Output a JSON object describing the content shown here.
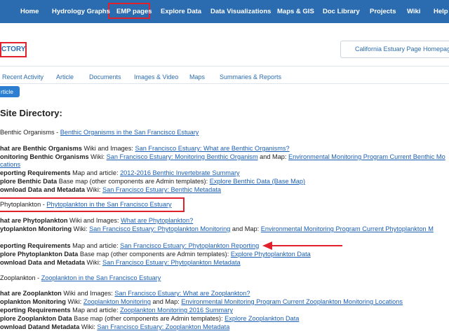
{
  "nav": {
    "items": [
      "Home",
      "Hydrology Graphs",
      "EMP pages",
      "Explore Data",
      "Data Visualizations",
      "Maps & GIS",
      "Doc Library",
      "Projects",
      "Wiki",
      "Help"
    ]
  },
  "header": {
    "title": "CTORY",
    "home_button": "California Estuary Page Homepage"
  },
  "tabs": [
    "Recent Activity",
    "Article",
    "Documents",
    "Images & Video",
    "Maps",
    "Summaries & Reports"
  ],
  "active_button": "rticle",
  "page_heading": "Site Directory:",
  "sections": {
    "benthic": {
      "title_prefix": "Benthic Organisms - ",
      "title_link": "Benthic Organisms in the San Francisco Estuary",
      "rows": [
        {
          "b": "hat are Benthic Organisms",
          "t1": " Wiki and Images: ",
          "l1": "San Francisco Estuary: What are Benthic Organisms?"
        },
        {
          "b": "onitoring Benthic Organisms",
          "t1": " Wiki: ",
          "l1": "San Francisco Estuary: Monitoring Benthic Organism",
          "t2": " and Map: ",
          "l2": "Environmental Monitoring Program Current Benthic Mo"
        },
        {
          "b": "",
          "t1": "",
          "l1": "cations"
        },
        {
          "b": "eporting Requirements",
          "t1": " Map and article: ",
          "l1": "2012-2016 Benthic Invertebrate Summary"
        },
        {
          "b": "plore Benthic Data",
          "t1": " Base map (other components are Admin templates): ",
          "l1": "Explore Benthic Data (Base Map)"
        },
        {
          "b": "ownload Data and Metadata",
          "t1": " Wiki: ",
          "l1": "San Francisco Estuary: Benthic Metadata"
        }
      ]
    },
    "phyto": {
      "title_prefix": "Phytoplankton - ",
      "title_link": "Phytoplankton in the San Francisco Estuary",
      "rows": [
        {
          "b": "hat are Phytoplankton",
          "t1": " Wiki and Images: ",
          "l1": "What are Phytoplankton?"
        },
        {
          "b": "ytoplankton Monitoring",
          "t1": " Wiki: ",
          "l1": "San Francisco Estuary: Phytoplankton Monitoring",
          "t2": " and Map: ",
          "l2": "Environmental Monitoring Program Current Phytoplankton M"
        },
        {
          "b": "eporting Requirements",
          "t1": " Map and article: ",
          "l1": "San Francisco Estuary: Phytoplankton Reporting"
        },
        {
          "b": "plore Phytoplankton Data",
          "t1": " Base map (other components are Admin templates): ",
          "l1": "Explore Phytoplankton Data"
        },
        {
          "b": "ownload Data and Metadata",
          "t1": " Wiki: ",
          "l1": "San Francisco Estuary: Phytoplankton Metadata"
        }
      ]
    },
    "zoo": {
      "title_prefix": "Zooplankton - ",
      "title_link": "Zooplankton in the San Francisco Estuary",
      "rows": [
        {
          "b": "hat are Zooplankton",
          "t1": " Wiki and Images: ",
          "l1": "San Francisco Estuary: What are Zooplankton?"
        },
        {
          "b": "oplankton Monitoring",
          "t1": " Wiki: ",
          "l1": "Zooplankton Monitoring",
          "t2": " and Map: ",
          "l2": "Environmental Monitoring Program Current Zooplankton Monitoring Locations"
        },
        {
          "b": "eporting Requirements",
          "t1": " Map and article: ",
          "l1": "Zooplankton Monitoring 2016 Summary"
        },
        {
          "b": "plore Zooplankton Data",
          "t1": " Base map (other components are Admin templates): ",
          "l1": "Explore Zooplankton Data"
        },
        {
          "b": "ownload Datand Metadata",
          "t1": " Wiki: ",
          "l1": "San Francisco Estuary: Zooplankton Metadata"
        }
      ]
    }
  },
  "colors": {
    "nav_bg": "#2b6cb0",
    "highlight": "#e0202a",
    "link": "#1a5fb4"
  }
}
